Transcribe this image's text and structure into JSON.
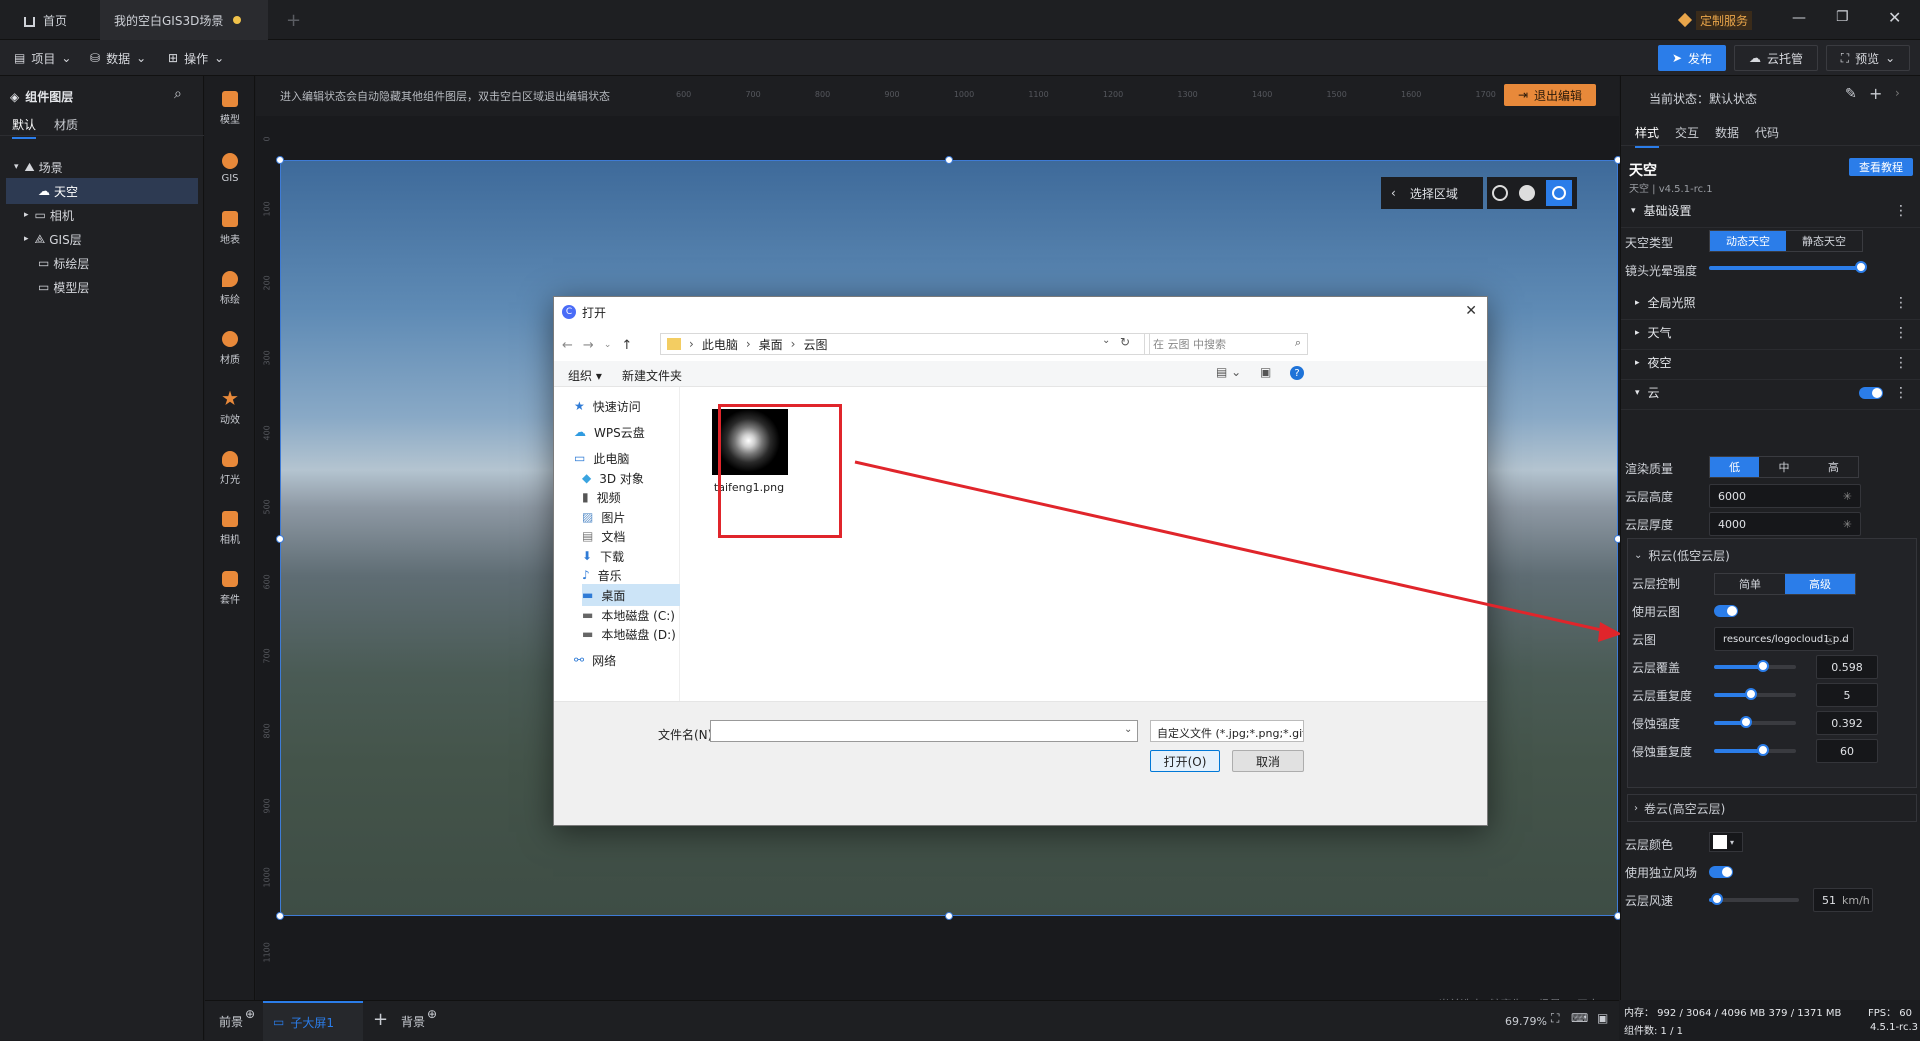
{
  "tabs": {
    "home": "首页",
    "scene": "我的空白GIS3D场景",
    "custom_service": "定制服务"
  },
  "menubar": {
    "project": "项目",
    "data": "数据",
    "operate": "操作",
    "publish": "发布",
    "cloud_host": "云托管",
    "preview": "预览"
  },
  "left_panel": {
    "title": "组件图层",
    "tabs": [
      "默认",
      "材质"
    ],
    "tree": [
      {
        "label": "场景"
      },
      {
        "label": "天空"
      },
      {
        "label": "相机"
      },
      {
        "label": "GIS层"
      },
      {
        "label": "标绘层"
      },
      {
        "label": "模型层"
      }
    ]
  },
  "toolbar": [
    {
      "label": "模型"
    },
    {
      "label": "GIS"
    },
    {
      "label": "地表"
    },
    {
      "label": "标绘"
    },
    {
      "label": "材质"
    },
    {
      "label": "动效"
    },
    {
      "label": "灯光"
    },
    {
      "label": "相机"
    },
    {
      "label": "套件"
    }
  ],
  "canvas": {
    "hint": "进入编辑状态会自动隐藏其他组件图层，双击空白区域退出编辑状态",
    "exit_edit": "退出编辑",
    "ruler_ticks": [
      "600",
      "700",
      "800",
      "900",
      "1000",
      "1100",
      "1200",
      "1300",
      "1400",
      "1500",
      "1600",
      "1700"
    ],
    "ruler_left_ticks": [
      "0",
      "100",
      "200",
      "300",
      "400",
      "500",
      "600",
      "700",
      "800",
      "900",
      "1000",
      "1100"
    ],
    "select_region": "选择区域",
    "breadcrumb": "当前选中: 鲸孪生 > 场景 > 天空"
  },
  "dialog": {
    "title": "打开",
    "path": [
      "此电脑",
      "桌面",
      "云图"
    ],
    "search_placeholder": "在 云图 中搜索",
    "organize": "组织 ▾",
    "new_folder": "新建文件夹",
    "nav": [
      {
        "label": "快速访问",
        "icon": "star-icon"
      },
      {
        "label": "WPS云盘",
        "icon": "cloud-icon"
      },
      {
        "label": "此电脑",
        "icon": "computer-icon"
      },
      {
        "label": "3D 对象",
        "icon": "cube-icon"
      },
      {
        "label": "视频",
        "icon": "video-icon"
      },
      {
        "label": "图片",
        "icon": "picture-icon"
      },
      {
        "label": "文档",
        "icon": "document-icon"
      },
      {
        "label": "下载",
        "icon": "download-icon"
      },
      {
        "label": "音乐",
        "icon": "music-icon"
      },
      {
        "label": "桌面",
        "icon": "desktop-icon"
      },
      {
        "label": "本地磁盘 (C:)",
        "icon": "drive-icon"
      },
      {
        "label": "本地磁盘 (D:)",
        "icon": "drive-icon"
      },
      {
        "label": "网络",
        "icon": "network-icon"
      }
    ],
    "file": {
      "name": "taifeng1.png"
    },
    "filename_label": "文件名(N):",
    "filename_value": "",
    "filetype": "自定义文件 (*.jpg;*.png;*.gif;*",
    "open": "打开(O)",
    "cancel": "取消"
  },
  "right_panel": {
    "state_label": "当前状态：默认状态",
    "tabs": [
      "样式",
      "交互",
      "数据",
      "代码"
    ],
    "component_name": "天空",
    "component_version": "天空 | v4.5.1-rc.1",
    "help_button": "查看教程",
    "basic_settings": "基础设置",
    "sky_type_label": "天空类型",
    "sky_type_options": [
      "动态天空",
      "静态天空"
    ],
    "lens_flare_label": "镜头光晕强度",
    "lens_flare_value": 1.0,
    "sections": [
      "全局光照",
      "天气",
      "夜空"
    ],
    "cloud_section": "云",
    "render_quality_label": "渲染质量",
    "render_quality_options": [
      "低",
      "中",
      "高"
    ],
    "cloud_height_label": "云层高度",
    "cloud_height": "6000",
    "cloud_thickness_label": "云层厚度",
    "cloud_thickness": "4000",
    "cumulus_label": "积云(低空云层)",
    "layer_control_label": "云层控制",
    "layer_control_options": [
      "简单",
      "高级"
    ],
    "use_cloudmap_label": "使用云图",
    "cloudmap_label": "云图",
    "cloudmap_value": "resources/logocloud1.p.d",
    "coverage_label": "云层覆盖",
    "coverage": "0.598",
    "coverage_frac": 0.6,
    "repeat_label": "云层重复度",
    "repeat": "5",
    "repeat_frac": 0.45,
    "erosion_label": "侵蚀强度",
    "erosion": "0.392",
    "erosion_frac": 0.39,
    "erosion_repeat_label": "侵蚀重复度",
    "erosion_repeat": "60",
    "erosion_repeat_frac": 0.6,
    "cirrus_label": "卷云(高空云层)",
    "cloud_color_label": "云层颜色",
    "cloud_color": "#ffffff",
    "independent_wind_label": "使用独立风场",
    "wind_speed_label": "云层风速",
    "wind_speed": "51",
    "wind_unit": "km/h"
  },
  "bottom": {
    "foreground": "前景",
    "sub_screen": "子大屏1",
    "background": "背景",
    "zoom": "69.79%"
  },
  "status": {
    "memory": "内存： 992 / 3064 / 4096 MB  379 / 1371 MB",
    "fps": "FPS： 60",
    "components": "组件数: 1 / 1",
    "version": "4.5.1-rc.3"
  }
}
